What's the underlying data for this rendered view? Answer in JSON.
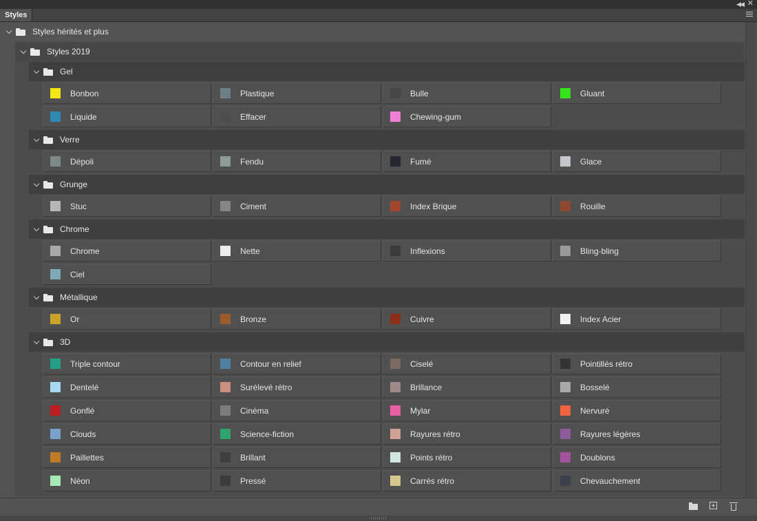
{
  "panel": {
    "tab_label": "Styles"
  },
  "tree": {
    "root_label": "Styles hérités et plus",
    "sub_label": "Styles 2019",
    "groups": [
      {
        "name": "Gel",
        "items": [
          {
            "label": "Bonbon",
            "swatch": "#f5e614"
          },
          {
            "label": "Plastique",
            "swatch": "#6d7e84"
          },
          {
            "label": "Bulle",
            "swatch": "#474747"
          },
          {
            "label": "Gluant",
            "swatch": "#35e31b"
          },
          {
            "label": "Liquide",
            "swatch": "#2f8ab3"
          },
          {
            "label": "Effacer",
            "swatch": "#4e4e4e"
          },
          {
            "label": "Chewing-gum",
            "swatch": "#f07fd5"
          }
        ]
      },
      {
        "name": "Verre",
        "items": [
          {
            "label": "Dépoli",
            "swatch": "#7d8a8a"
          },
          {
            "label": "Fendu",
            "swatch": "#8e9a99"
          },
          {
            "label": "Fumé",
            "swatch": "#262632"
          },
          {
            "label": "Glace",
            "swatch": "#c3c7cb"
          }
        ]
      },
      {
        "name": "Grunge",
        "items": [
          {
            "label": "Stuc",
            "swatch": "#b7b7b7"
          },
          {
            "label": "Ciment",
            "swatch": "#858882"
          },
          {
            "label": "Index Brique",
            "swatch": "#a3442c"
          },
          {
            "label": "Rouille",
            "swatch": "#8f4832"
          }
        ]
      },
      {
        "name": "Chrome",
        "items": [
          {
            "label": "Chrome",
            "swatch": "#a9a9a9"
          },
          {
            "label": "Nette",
            "swatch": "#ececec"
          },
          {
            "label": "Inflexions",
            "swatch": "#3b3b3b"
          },
          {
            "label": "Bling-bling",
            "swatch": "#9a9a9a"
          },
          {
            "label": "Ciel",
            "swatch": "#7fa8b8"
          }
        ]
      },
      {
        "name": "Métallique",
        "items": [
          {
            "label": "Or",
            "swatch": "#c9a227"
          },
          {
            "label": "Bronze",
            "swatch": "#9c5a2d"
          },
          {
            "label": "Cuivre",
            "swatch": "#8d2f18"
          },
          {
            "label": "Index Acier",
            "swatch": "#f2f2f2"
          }
        ]
      },
      {
        "name": "3D",
        "items": [
          {
            "label": "Triple contour",
            "swatch": "#23a086"
          },
          {
            "label": "Contour en relief",
            "swatch": "#4f80a2"
          },
          {
            "label": "Ciselé",
            "swatch": "#7b6a5f"
          },
          {
            "label": "Pointillés rétro",
            "swatch": "#333333"
          },
          {
            "label": "Dentelé",
            "swatch": "#a8d9f2"
          },
          {
            "label": "Surélevé rétro",
            "swatch": "#c98f7f"
          },
          {
            "label": "Brillance",
            "swatch": "#a08987"
          },
          {
            "label": "Bosselé",
            "swatch": "#a9a9ac"
          },
          {
            "label": "Gonflé",
            "swatch": "#bd1c20"
          },
          {
            "label": "Cinéma",
            "swatch": "#7c7c7c"
          },
          {
            "label": "Mylar",
            "swatch": "#e85ea3"
          },
          {
            "label": "Nervuré",
            "swatch": "#ee6441"
          },
          {
            "label": "Clouds",
            "swatch": "#78a2c9"
          },
          {
            "label": "Science-fiction",
            "swatch": "#2ea36e"
          },
          {
            "label": "Rayures rétro",
            "swatch": "#d2a196"
          },
          {
            "label": "Rayures légères",
            "swatch": "#8e5c9c"
          },
          {
            "label": "Paillettes",
            "swatch": "#bf7a23"
          },
          {
            "label": "Brillant",
            "swatch": "#3f3f3f"
          },
          {
            "label": "Points rétro",
            "swatch": "#cfe5df"
          },
          {
            "label": "Doublons",
            "swatch": "#a2539b"
          },
          {
            "label": "Néon",
            "swatch": "#a4e8b6"
          },
          {
            "label": "Pressé",
            "swatch": "#3c3c3c"
          },
          {
            "label": "Carrés rétro",
            "swatch": "#d5c88e"
          },
          {
            "label": "Chevauchement",
            "swatch": "#3c3f4c"
          }
        ]
      }
    ]
  },
  "footer": {
    "icons": [
      "new-group-icon",
      "new-style-icon",
      "delete-icon"
    ]
  }
}
